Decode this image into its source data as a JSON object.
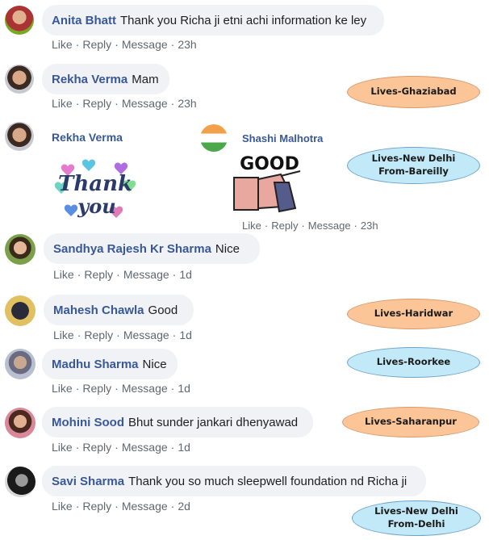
{
  "comments": [
    {
      "name": "Anita Bhatt",
      "text": "Thank you Richa ji etni achi information ke ley",
      "time": "23h"
    },
    {
      "name": "Rekha Verma",
      "text": "Mam",
      "time": "23h"
    },
    {
      "name": "Rekha Verma",
      "text": "",
      "time": ""
    },
    {
      "name": "Sandhya Rajesh Kr Sharma",
      "text": "Nice",
      "time": "1d"
    },
    {
      "name": "Mahesh Chawla",
      "text": "Good",
      "time": "1d"
    },
    {
      "name": "Madhu Sharma",
      "text": "Nice",
      "time": "1d"
    },
    {
      "name": "Mohini Sood",
      "text": "Bhut sunder jankari dhenyawad",
      "time": "1d"
    },
    {
      "name": "Savi Sharma",
      "text": "Thank you so much sleepwell foundation nd Richa ji",
      "time": "2d"
    }
  ],
  "reply": {
    "name": "Shashi Malhotra",
    "time": "23h"
  },
  "actions": {
    "like": "Like",
    "reply": "Reply",
    "message": "Message",
    "sep": "·"
  },
  "stickers": {
    "thank_you": {
      "line1": "Thank",
      "line2": "you"
    },
    "good": {
      "text": "GOOD"
    }
  },
  "location_labels": [
    {
      "line1": "Lives-Ghaziabad",
      "line2": "",
      "color": "#fbc598"
    },
    {
      "line1": "Lives-New Delhi",
      "line2": "From-Bareilly",
      "color": "#c2e9f7"
    },
    {
      "line1": "Lives-Haridwar",
      "line2": "",
      "color": "#fbc598"
    },
    {
      "line1": "Lives-Roorkee",
      "line2": "",
      "color": "#c2e9f7"
    },
    {
      "line1": "Lives-Saharanpur",
      "line2": "",
      "color": "#fbc598"
    },
    {
      "line1": "Lives-New Delhi",
      "line2": "From-Delhi",
      "color": "#c2e9f7"
    }
  ]
}
